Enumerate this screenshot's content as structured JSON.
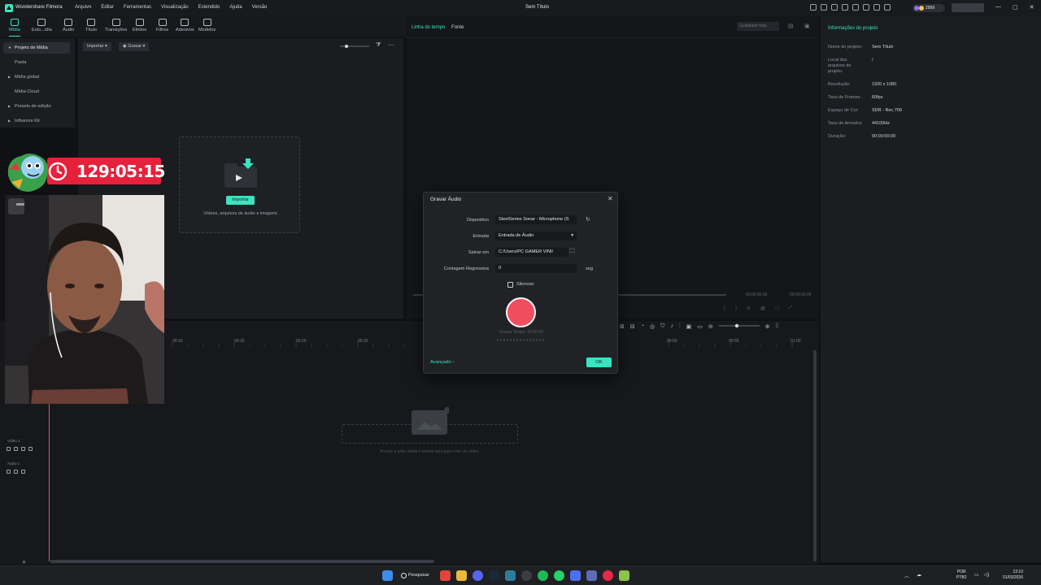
{
  "app": {
    "name": "Wondershare Filmora",
    "document_title": "Sem Título",
    "menu": [
      "Arquivo",
      "Editar",
      "Ferramentas",
      "Visualização",
      "Estendido",
      "Ajuda",
      "Versão"
    ],
    "coins": "2999"
  },
  "toolbar": {
    "items": [
      {
        "label": "Mídia",
        "icon": "media-icon",
        "active": true
      },
      {
        "label": "Esto...ídia",
        "icon": "stock-media-icon"
      },
      {
        "label": "Áudio",
        "icon": "audio-icon"
      },
      {
        "label": "Título",
        "icon": "title-icon"
      },
      {
        "label": "Transições",
        "icon": "transitions-icon"
      },
      {
        "label": "Efeitos",
        "icon": "effects-icon"
      },
      {
        "label": "Filtros",
        "icon": "filters-icon"
      },
      {
        "label": "Adesivos",
        "icon": "stickers-icon"
      },
      {
        "label": "Modelos",
        "icon": "templates-icon"
      }
    ]
  },
  "sidebar": {
    "items": [
      {
        "label": "Projeto de Mídia",
        "selected": true,
        "arrow": true
      },
      {
        "label": "Pasta"
      },
      {
        "label": "Mídia global",
        "arrow": true
      },
      {
        "label": "Mídia Cloud"
      },
      {
        "label": "Presets de edição",
        "arrow": true
      },
      {
        "label": "Influence Kit",
        "arrow": true
      }
    ]
  },
  "media": {
    "import_label": "Importar",
    "record_label": "Gravar",
    "drop_button": "Importar",
    "drop_hint": "Vídeos, arquivos de áudio e imagens"
  },
  "preview": {
    "tab_timeline": "Linha do tempo",
    "tab_source": "Fonte",
    "quality": "Qualidade total",
    "time_current": "00:00:00:00",
    "time_total": "00:00:00:00"
  },
  "project_info": {
    "header": "Informações do projeto",
    "rows": [
      {
        "key": "Nome do projeto:",
        "value": "Sem Título"
      },
      {
        "key": "Local dos arquivos do projeto:",
        "value": "/"
      },
      {
        "key": "Resolução:",
        "value": "1920 x 1080"
      },
      {
        "key": "Taxa de Frames:",
        "value": "60fps"
      },
      {
        "key": "Espaço de Cor:",
        "value": "SDR - Rec.709"
      },
      {
        "key": "Taxa de Amostra:",
        "value": "44100Hz"
      },
      {
        "key": "Duração:",
        "value": "00:00:00:00"
      }
    ]
  },
  "timeline": {
    "ticks": [
      "00:10",
      "00:15",
      "00:20",
      "00:25",
      "00:50",
      "00:55",
      "01:00"
    ],
    "video_track": "Vídeo 1",
    "audio_track": "Áudio 1",
    "drop_hint": "Arraste e solte mídia e efeitos aqui para criar um vídeo."
  },
  "overlay": {
    "timer": "129:05:15"
  },
  "dialog": {
    "title": "Gravar Áudio",
    "device_label": "Dispositivo",
    "device_value": "SteelSeries Sonar - Microphone (S",
    "input_label": "Entrada",
    "input_value": "Entrada de Áudio",
    "save_label": "Salvar em",
    "save_value": "C:/Users/PC GAMER VINI/",
    "countdown_label": "Contagem Regressiva",
    "countdown_value": "0",
    "countdown_unit": "seg",
    "mute_label": "Silenciar",
    "record_time": "Gravar Tempo: 00:00:00",
    "advanced": "Avançado",
    "ok": "OK"
  },
  "taskbar": {
    "search": "Pesquisar",
    "lang1": "POR",
    "lang2": "PTB2",
    "time": "13:10",
    "date": "01/03/2026"
  },
  "colors": {
    "accent": "#37e6c1",
    "record": "#f04e5f",
    "timer_badge": "#e6213c"
  }
}
